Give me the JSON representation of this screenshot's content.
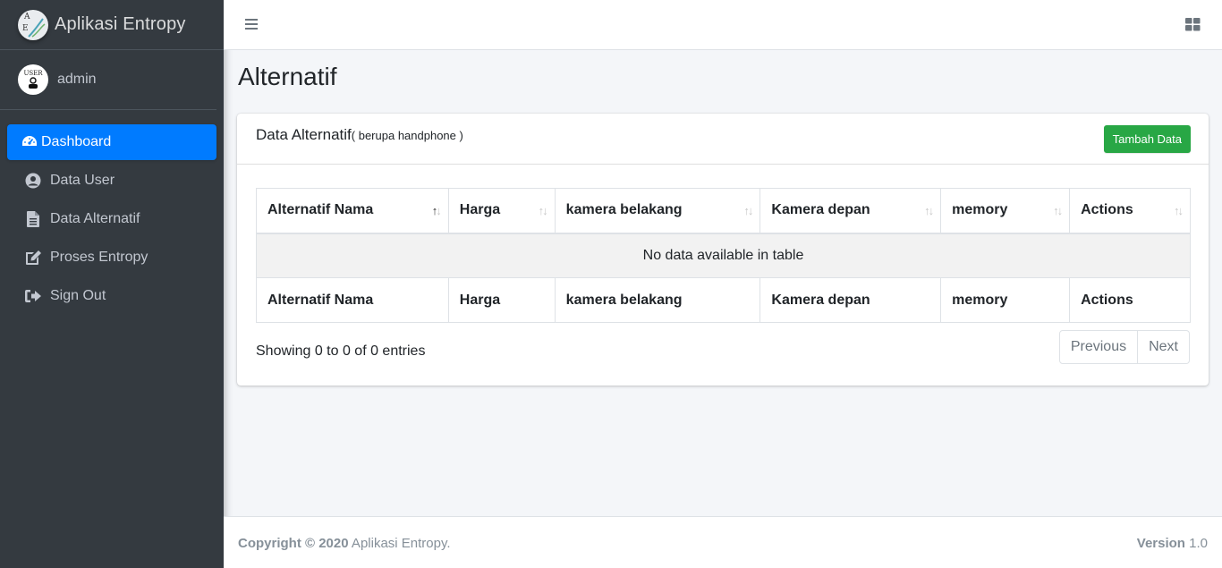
{
  "brand": {
    "name": "Aplikasi Entropy",
    "logo_letters": [
      "A",
      "E"
    ]
  },
  "user": {
    "avatar_text": "USER",
    "name": "admin"
  },
  "sidebar": {
    "items": [
      {
        "label": "Dashboard",
        "icon": "tachometer-icon",
        "active": true
      },
      {
        "label": "Data User",
        "icon": "user-circle-icon"
      },
      {
        "label": "Data Alternatif",
        "icon": "file-icon"
      },
      {
        "label": "Proses Entropy",
        "icon": "edit-icon"
      },
      {
        "label": "Sign Out",
        "icon": "sign-out-icon"
      }
    ]
  },
  "header": {
    "menu_icon": "hamburger-icon",
    "right_icon": "grid-icon"
  },
  "page": {
    "title": "Alternatif"
  },
  "card": {
    "title": "Data Alternatif",
    "subtitle": "( berupa handphone )",
    "add_button": "Tambah Data"
  },
  "table": {
    "columns": [
      "Alternatif Nama",
      "Harga",
      "kamera belakang",
      "Kamera depan",
      "memory",
      "Actions"
    ],
    "empty_message": "No data available in table",
    "info": "Showing 0 to 0 of 0 entries",
    "pager": {
      "previous": "Previous",
      "next": "Next"
    }
  },
  "footer": {
    "copyright_bold": "Copyright © 2020",
    "copyright_text": " Aplikasi Entropy.",
    "version_label": "Version",
    "version_value": " 1.0"
  },
  "colors": {
    "sidebar_bg": "#343a40",
    "active": "#007bff",
    "success": "#28a745",
    "content_bg": "#f4f6f9"
  }
}
